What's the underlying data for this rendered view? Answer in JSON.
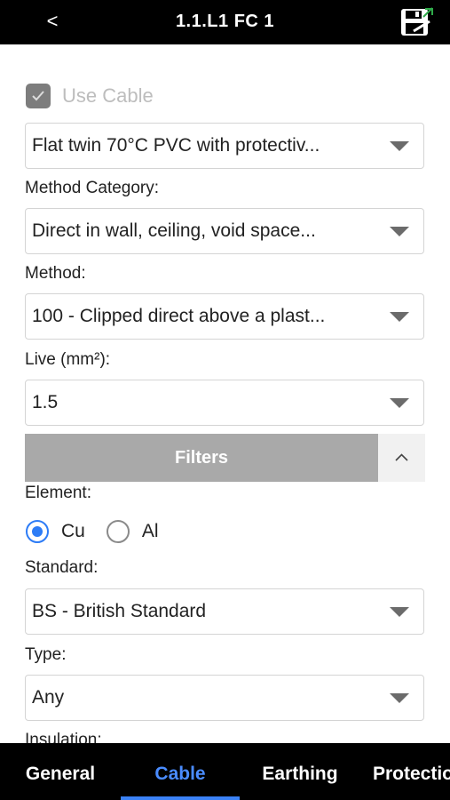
{
  "header": {
    "back_label": "<",
    "title": "1.1.L1 FC 1",
    "save_icon": "save-icon"
  },
  "form": {
    "use_cable_label": "Use Cable",
    "use_cable_checked": true,
    "cable_type_value": "Flat twin 70°C PVC with protectiv...",
    "method_category_label": "Method Category:",
    "method_category_value": "Direct in wall, ceiling, void space...",
    "method_label": "Method:",
    "method_value": "100 - Clipped direct above a plast...",
    "live_label": "Live (mm²):",
    "live_value": "1.5"
  },
  "filters": {
    "bar_label": "Filters",
    "element_label": "Element:",
    "element_options": [
      {
        "label": "Cu",
        "selected": true
      },
      {
        "label": "Al",
        "selected": false
      }
    ],
    "standard_label": "Standard:",
    "standard_value": "BS - British Standard",
    "type_label": "Type:",
    "type_value": "Any",
    "insulation_label": "Insulation:"
  },
  "tabs": [
    {
      "label": "General",
      "active": false
    },
    {
      "label": "Cable",
      "active": true
    },
    {
      "label": "Earthing",
      "active": false
    },
    {
      "label": "Protectio",
      "active": false
    }
  ],
  "colors": {
    "accent": "#2d7cf6",
    "tab_active": "#4a8cff",
    "filters_bar": "#a9a9a9"
  }
}
